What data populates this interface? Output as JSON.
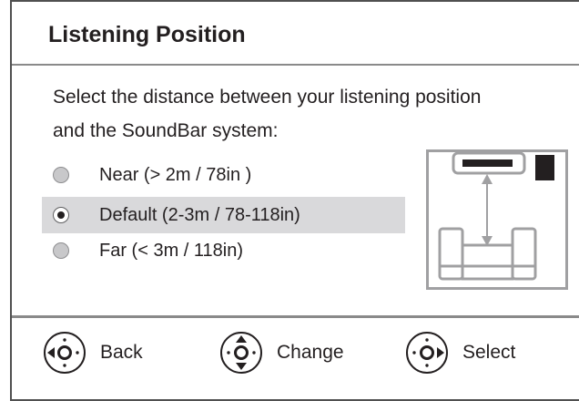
{
  "dialog": {
    "title": "Listening Position",
    "instruction_line1": "Select the distance between your listening position",
    "instruction_line2": "and the SoundBar system:"
  },
  "options": [
    {
      "label": "Near (> 2m / 78in )",
      "selected": false
    },
    {
      "label": "Default (2-3m / 78-118in)",
      "selected": true
    },
    {
      "label": "Far (< 3m / 118in)",
      "selected": false
    }
  ],
  "diagram": {
    "icon": "listening-distance-diagram",
    "colors": {
      "outline": "#a0a0a2",
      "soundbar": "#231f20",
      "highlight_bg": "#d9d9db"
    }
  },
  "footer": {
    "back_label": "Back",
    "back_icon": "remote-left-arrow-icon",
    "change_label": "Change",
    "change_icon": "remote-up-down-icon",
    "select_label": "Select",
    "select_icon": "remote-right-arrow-icon"
  }
}
